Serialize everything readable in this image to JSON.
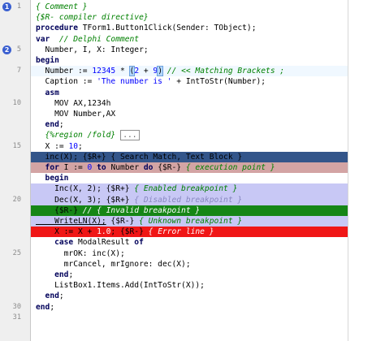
{
  "editor": {
    "lines": [
      {
        "n": "1",
        "bookmark": "1",
        "cls": "",
        "parts": [
          [
            "cm",
            "{ Comment }"
          ]
        ]
      },
      {
        "n": "",
        "cls": "",
        "parts": [
          [
            "dir",
            "{$R- compiler directive}"
          ]
        ]
      },
      {
        "n": "",
        "cls": "",
        "parts": [
          [
            "kw",
            "procedure "
          ],
          [
            "sym",
            "TForm1.Button1Click(Sender: TObject);"
          ]
        ]
      },
      {
        "n": "",
        "cls": "",
        "parts": [
          [
            "kw",
            "var "
          ],
          [
            "cm",
            " // Delphi Comment"
          ]
        ]
      },
      {
        "n": "5",
        "bookmark": "2",
        "cls": "",
        "parts": [
          [
            "sym",
            "  Number, I, X: Integer;"
          ]
        ]
      },
      {
        "n": "",
        "cls": "",
        "parts": [
          [
            "kw",
            "begin"
          ]
        ]
      },
      {
        "n": "7",
        "cls": "row-caret",
        "parts": [
          [
            "sym",
            "  Number := "
          ],
          [
            "num",
            "12345"
          ],
          [
            "sym",
            " * "
          ],
          [
            "bracket",
            "("
          ],
          [
            "num",
            "2"
          ],
          [
            "sym",
            " + "
          ],
          [
            "num",
            "9"
          ],
          [
            "bracket",
            ")"
          ],
          [
            "cm",
            " // << Matching Brackets ;"
          ]
        ]
      },
      {
        "n": "",
        "cls": "",
        "parts": [
          [
            "sym",
            "  Caption := "
          ],
          [
            "str",
            "'The number is '"
          ],
          [
            "sym",
            " + IntToStr(Number);"
          ]
        ]
      },
      {
        "n": "",
        "cls": "",
        "parts": [
          [
            "kw",
            "  asm"
          ]
        ]
      },
      {
        "n": "10",
        "cls": "",
        "parts": [
          [
            "sym",
            "    MOV AX,1234h"
          ]
        ]
      },
      {
        "n": "",
        "cls": "",
        "parts": [
          [
            "sym",
            "    MOV Number,AX"
          ]
        ]
      },
      {
        "n": "",
        "cls": "",
        "parts": [
          [
            "kw",
            "  end"
          ],
          [
            "sym",
            ";"
          ]
        ]
      },
      {
        "n": "",
        "cls": "",
        "parts": [
          [
            "cm",
            "  {%region /fold}"
          ],
          [
            "collapsed",
            "..."
          ]
        ]
      },
      {
        "n": "15",
        "cls": "",
        "parts": [
          [
            "sym",
            "  X := "
          ],
          [
            "num",
            "10"
          ],
          [
            "sym",
            ";"
          ]
        ]
      },
      {
        "n": "",
        "cls": "row-search",
        "parts": [
          [
            "sym",
            "  inc(X); {$R+} { Search Match, Text Block }"
          ]
        ]
      },
      {
        "n": "",
        "cls": "row-exec",
        "parts": [
          [
            "kw",
            "  for "
          ],
          [
            "sym",
            "I := "
          ],
          [
            "num",
            "0"
          ],
          [
            "kw",
            " to "
          ],
          [
            "sym",
            "Number "
          ],
          [
            "kw",
            "do "
          ],
          [
            "sym",
            "{$R-} "
          ],
          [
            "cm",
            "{ execution point }"
          ]
        ]
      },
      {
        "n": "",
        "cls": "",
        "parts": [
          [
            "kw",
            "  begin"
          ]
        ]
      },
      {
        "n": "",
        "cls": "row-enabled",
        "parts": [
          [
            "sym",
            "    Inc(X, 2); {$R+} "
          ],
          [
            "cm",
            "{ Enabled breakpoint }"
          ]
        ]
      },
      {
        "n": "20",
        "cls": "row-disabled",
        "parts": [
          [
            "sym",
            "    Dec(X, 3); {$R+} "
          ],
          [
            "cm",
            "{ Disabled breakpoint }"
          ]
        ]
      },
      {
        "n": "",
        "cls": "row-invalid",
        "parts": [
          [
            "sym",
            "    {$R-} "
          ],
          [
            "cm",
            "// { Invalid breakpoint }"
          ]
        ]
      },
      {
        "n": "",
        "cls": "row-unknown",
        "parts": [
          [
            "ul",
            "    WriteLN(X);"
          ],
          [
            "sym",
            " {$R-} "
          ],
          [
            "cm",
            "{ Unknown breakpoint }"
          ]
        ]
      },
      {
        "n": "",
        "cls": "row-error",
        "parts": [
          [
            "sym",
            "    X := X + "
          ],
          [
            "num",
            "1.0"
          ],
          [
            "sym",
            "; {$R-} "
          ],
          [
            "cm",
            "{ Error line }"
          ]
        ]
      },
      {
        "n": "",
        "cls": "",
        "parts": [
          [
            "kw",
            "    case "
          ],
          [
            "sym",
            "ModalResult "
          ],
          [
            "kw",
            "of"
          ]
        ]
      },
      {
        "n": "25",
        "cls": "",
        "parts": [
          [
            "sym",
            "      mrOK: inc(X);"
          ]
        ]
      },
      {
        "n": "",
        "cls": "",
        "parts": [
          [
            "sym",
            "      mrCancel, mrIgnore: dec(X);"
          ]
        ]
      },
      {
        "n": "",
        "cls": "",
        "parts": [
          [
            "kw",
            "    end"
          ],
          [
            "sym",
            ";"
          ]
        ]
      },
      {
        "n": "",
        "cls": "",
        "parts": [
          [
            "sym",
            "    ListBox1.Items.Add(IntToStr(X));"
          ]
        ]
      },
      {
        "n": "",
        "cls": "",
        "parts": [
          [
            "kw",
            "  end"
          ],
          [
            "sym",
            ";"
          ]
        ]
      },
      {
        "n": "30",
        "cls": "",
        "parts": [
          [
            "kw",
            "end"
          ],
          [
            "sym",
            ";"
          ]
        ]
      },
      {
        "n": "31",
        "cls": "",
        "parts": []
      }
    ]
  }
}
